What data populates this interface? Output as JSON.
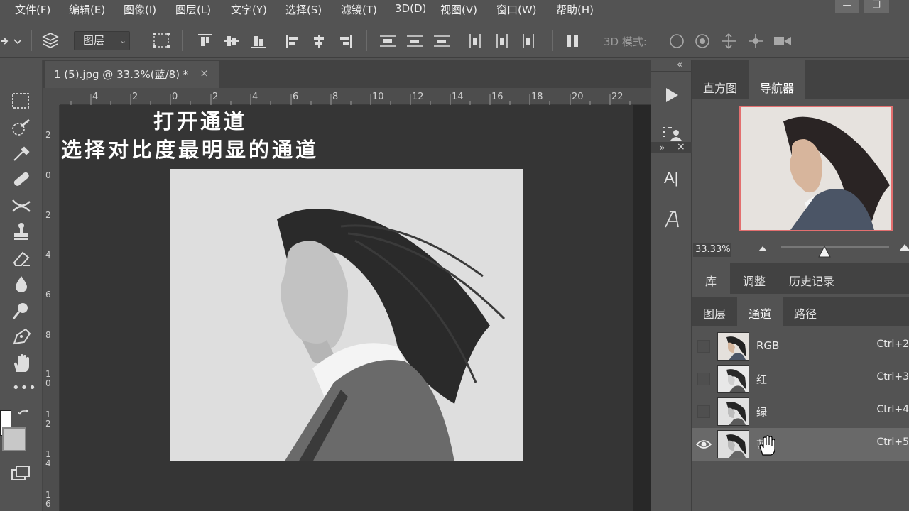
{
  "menu": [
    "文件(F)",
    "编辑(E)",
    "图像(I)",
    "图层(L)",
    "文字(Y)",
    "选择(S)",
    "滤镜(T)",
    "3D(D)",
    "视图(V)",
    "窗口(W)",
    "帮助(H)"
  ],
  "window_controls": {
    "minimize": "—",
    "restore": "❐"
  },
  "options_bar": {
    "layer_select": "图层",
    "mode_3d_label": "3D 模式:"
  },
  "document": {
    "tab_title": "1 (5).jpg @ 33.3%(蓝/8) *",
    "close": "×"
  },
  "ruler": {
    "top_ticks": [
      "4",
      "2",
      "0",
      "2",
      "4",
      "6",
      "8",
      "10",
      "12",
      "14",
      "16",
      "18",
      "20",
      "22"
    ],
    "left_ticks": [
      "2",
      "0",
      "2",
      "4",
      "6",
      "8",
      "1\n0",
      "1\n2",
      "1\n4",
      "1\n6"
    ]
  },
  "overlay_text": {
    "line1": "打开通道",
    "line2": "选择对比度最明显的通道"
  },
  "right_dock": {
    "collapse_top": "«",
    "collapse_mid": "»",
    "close_mid": "×",
    "type_char": "A|"
  },
  "nav_panel": {
    "tabs": [
      "直方图",
      "导航器"
    ],
    "active_tab": 1,
    "zoom_value": "33.33%"
  },
  "mid_panel": {
    "tabs": [
      "库",
      "调整",
      "历史记录"
    ]
  },
  "channel_panel": {
    "tabs": [
      "图层",
      "通道",
      "路径"
    ],
    "active_tab": 1,
    "channels": [
      {
        "name": "RGB",
        "shortcut": "Ctrl+2",
        "visible": false
      },
      {
        "name": "红",
        "shortcut": "Ctrl+3",
        "visible": false
      },
      {
        "name": "绿",
        "shortcut": "Ctrl+4",
        "visible": false
      },
      {
        "name": "蓝",
        "shortcut": "Ctrl+5",
        "visible": true
      }
    ]
  },
  "colors": {
    "ui_bg": "#535353",
    "canvas_bg": "#353535",
    "highlight_row": "#696969",
    "nav_frame": "#e36f6f"
  }
}
